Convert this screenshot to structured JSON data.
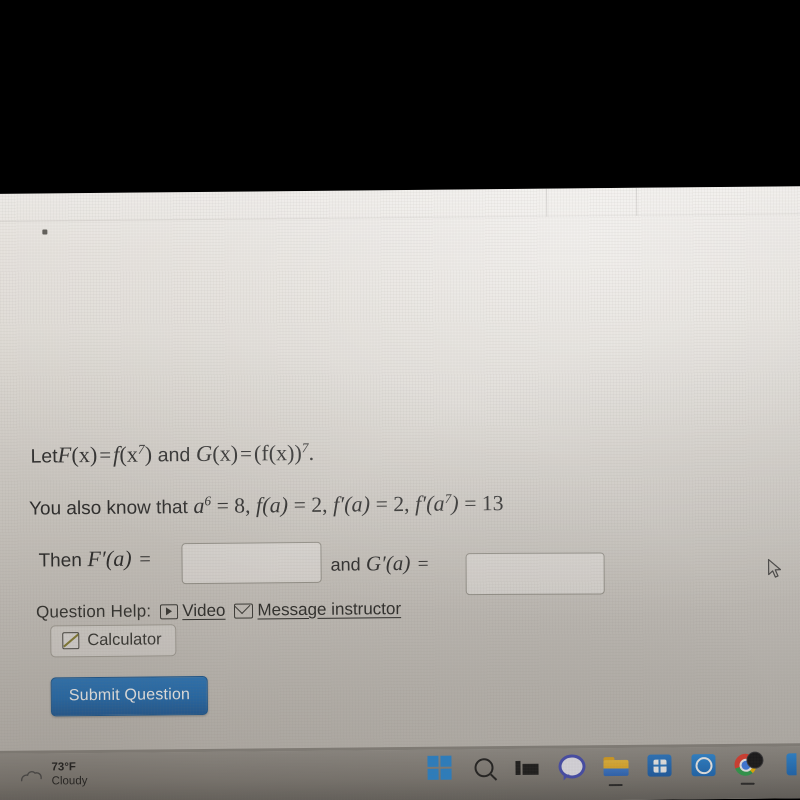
{
  "problem": {
    "line1": {
      "lead": "Let",
      "F": "F",
      "of_x": "(x)",
      "eq": "=",
      "f": "f",
      "arg": "(x",
      "exp7": "7",
      "close": ")",
      "and": "and",
      "G": "G",
      "G_of_x": "(x)",
      "eq2": "=",
      "fx": "(f(x))",
      "exp7b": "7",
      "period": ".",
      "full_text": "Let F(x) = f(x⁷) and G(x) = (f(x))⁷ ."
    },
    "line2": {
      "lead": "You also know that",
      "a": "a",
      "exp6": "6",
      "eq_8": "= 8,",
      "fa": "f(a)",
      "eq_2": "= 2,",
      "fpa": "f′(a)",
      "eq_2b": "= 2,",
      "fpa7": "f′(a",
      "exp7": "7",
      "fpa7_close": ")",
      "eq_13": "= 13",
      "full_text": "You also know that a⁶ = 8, f(a) = 2, f′(a) = 2, f′(a⁷) = 13"
    },
    "answer_line": {
      "then": "Then",
      "Fprime_a": "F′(a)",
      "equals": "=",
      "and": "and",
      "Gprime_a": "G′(a)",
      "equals2": "=",
      "box1_value": "",
      "box2_value": "",
      "box1_placeholder": "",
      "box2_placeholder": ""
    }
  },
  "question_help": {
    "label": "Question Help:",
    "video_link": "Video",
    "message_link": "Message instructor",
    "calculator_button": "Calculator"
  },
  "submit": {
    "label": "Submit Question"
  },
  "taskbar": {
    "weather": {
      "temperature": "73°F",
      "condition": "Cloudy"
    },
    "icons": [
      {
        "name": "start-icon",
        "label": "Start"
      },
      {
        "name": "search-icon",
        "label": "Search"
      },
      {
        "name": "task-view-icon",
        "label": "Task View"
      },
      {
        "name": "chat-icon",
        "label": "Chat"
      },
      {
        "name": "file-explorer-icon",
        "label": "File Explorer"
      },
      {
        "name": "microsoft-store-icon",
        "label": "Microsoft Store"
      },
      {
        "name": "mail-icon",
        "label": "Mail"
      },
      {
        "name": "chrome-icon",
        "label": "Google Chrome"
      }
    ]
  },
  "colors": {
    "submit_blue": "#2471b8",
    "page_background": "#d6d2cc",
    "text": "#2b2b2b",
    "taskbar": "#817d77",
    "letterbox": "#000000"
  }
}
